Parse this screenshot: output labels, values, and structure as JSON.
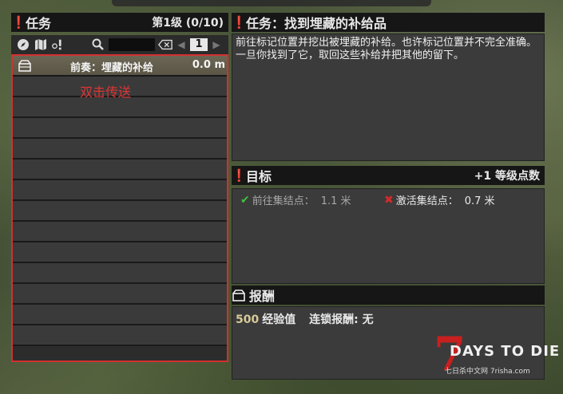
{
  "quest_log": {
    "title": "任务",
    "tier": "第1级 (0/10)",
    "page": "1",
    "quests": [
      {
        "name": "前奏：埋藏的补给",
        "distance": "0.0 m",
        "selected": true
      }
    ],
    "empty_rows": 13,
    "annotation": "双击传送"
  },
  "quest_detail": {
    "title": "任务：找到埋藏的补给品",
    "description": "前往标记位置并挖出被埋藏的补给。也许标记位置并不完全准确。一旦你找到了它，取回这些补给并把其他的留下。"
  },
  "objectives": {
    "title": "目标",
    "bonus": "+1 等级点数",
    "items": [
      {
        "label": "前往集结点：",
        "value": "1.1 米",
        "status": "complete"
      },
      {
        "label": "激活集结点：",
        "value": "0.7 米",
        "status": "failed"
      }
    ]
  },
  "rewards": {
    "title": "报酬",
    "xp": "500",
    "xp_label": "经验值",
    "chain_label": "连锁报酬: 无"
  },
  "watermark": {
    "logo_numeral": "7",
    "logo_text": "DAYS TO DIE",
    "site": "七日杀中文网 7risha.com"
  },
  "colors": {
    "highlight_border": "#d23030",
    "selected_row": "#6b6654",
    "check": "#3fc13f",
    "cross": "#d42a2a"
  }
}
